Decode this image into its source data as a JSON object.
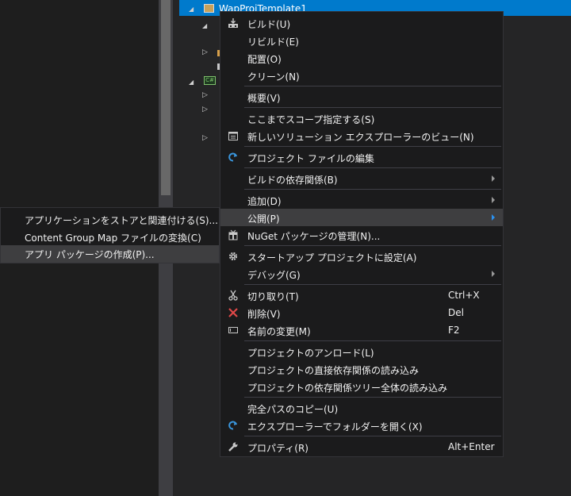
{
  "tree": {
    "selected_title": "WapProjTemplate1"
  },
  "context_menu": {
    "build": "ビルド(U)",
    "rebuild": "リビルド(E)",
    "deploy": "配置(O)",
    "clean": "クリーン(N)",
    "overview": "概要(V)",
    "scope_here": "ここまでスコープ指定する(S)",
    "new_solution_view": "新しいソリューション エクスプローラーのビュー(N)",
    "edit_project_file": "プロジェクト ファイルの編集",
    "build_dependencies": "ビルドの依存関係(B)",
    "add": "追加(D)",
    "publish": "公開(P)",
    "manage_nuget": "NuGet パッケージの管理(N)...",
    "set_startup": "スタートアップ プロジェクトに設定(A)",
    "debug": "デバッグ(G)",
    "cut": "切り取り(T)",
    "cut_shortcut": "Ctrl+X",
    "delete": "削除(V)",
    "delete_shortcut": "Del",
    "rename": "名前の変更(M)",
    "rename_shortcut": "F2",
    "unload_project": "プロジェクトのアンロード(L)",
    "load_direct_deps": "プロジェクトの直接依存関係の読み込み",
    "load_entire_tree": "プロジェクトの依存関係ツリー全体の読み込み",
    "copy_full_path": "完全パスのコピー(U)",
    "open_in_explorer": "エクスプローラーでフォルダーを開く(X)",
    "properties": "プロパティ(R)",
    "properties_shortcut": "Alt+Enter"
  },
  "publish_submenu": {
    "associate_store": "アプリケーションをストアと関連付ける(S)...",
    "convert_content_group_map": "Content Group Map ファイルの変換(C)",
    "create_app_packages": "アプリ パッケージの作成(P)..."
  },
  "colors": {
    "selection": "#007acc",
    "menu_bg": "#1b1b1c",
    "hover": "#3e3e40",
    "delete_icon": "#e04848",
    "refresh_icon": "#3a96dd"
  }
}
